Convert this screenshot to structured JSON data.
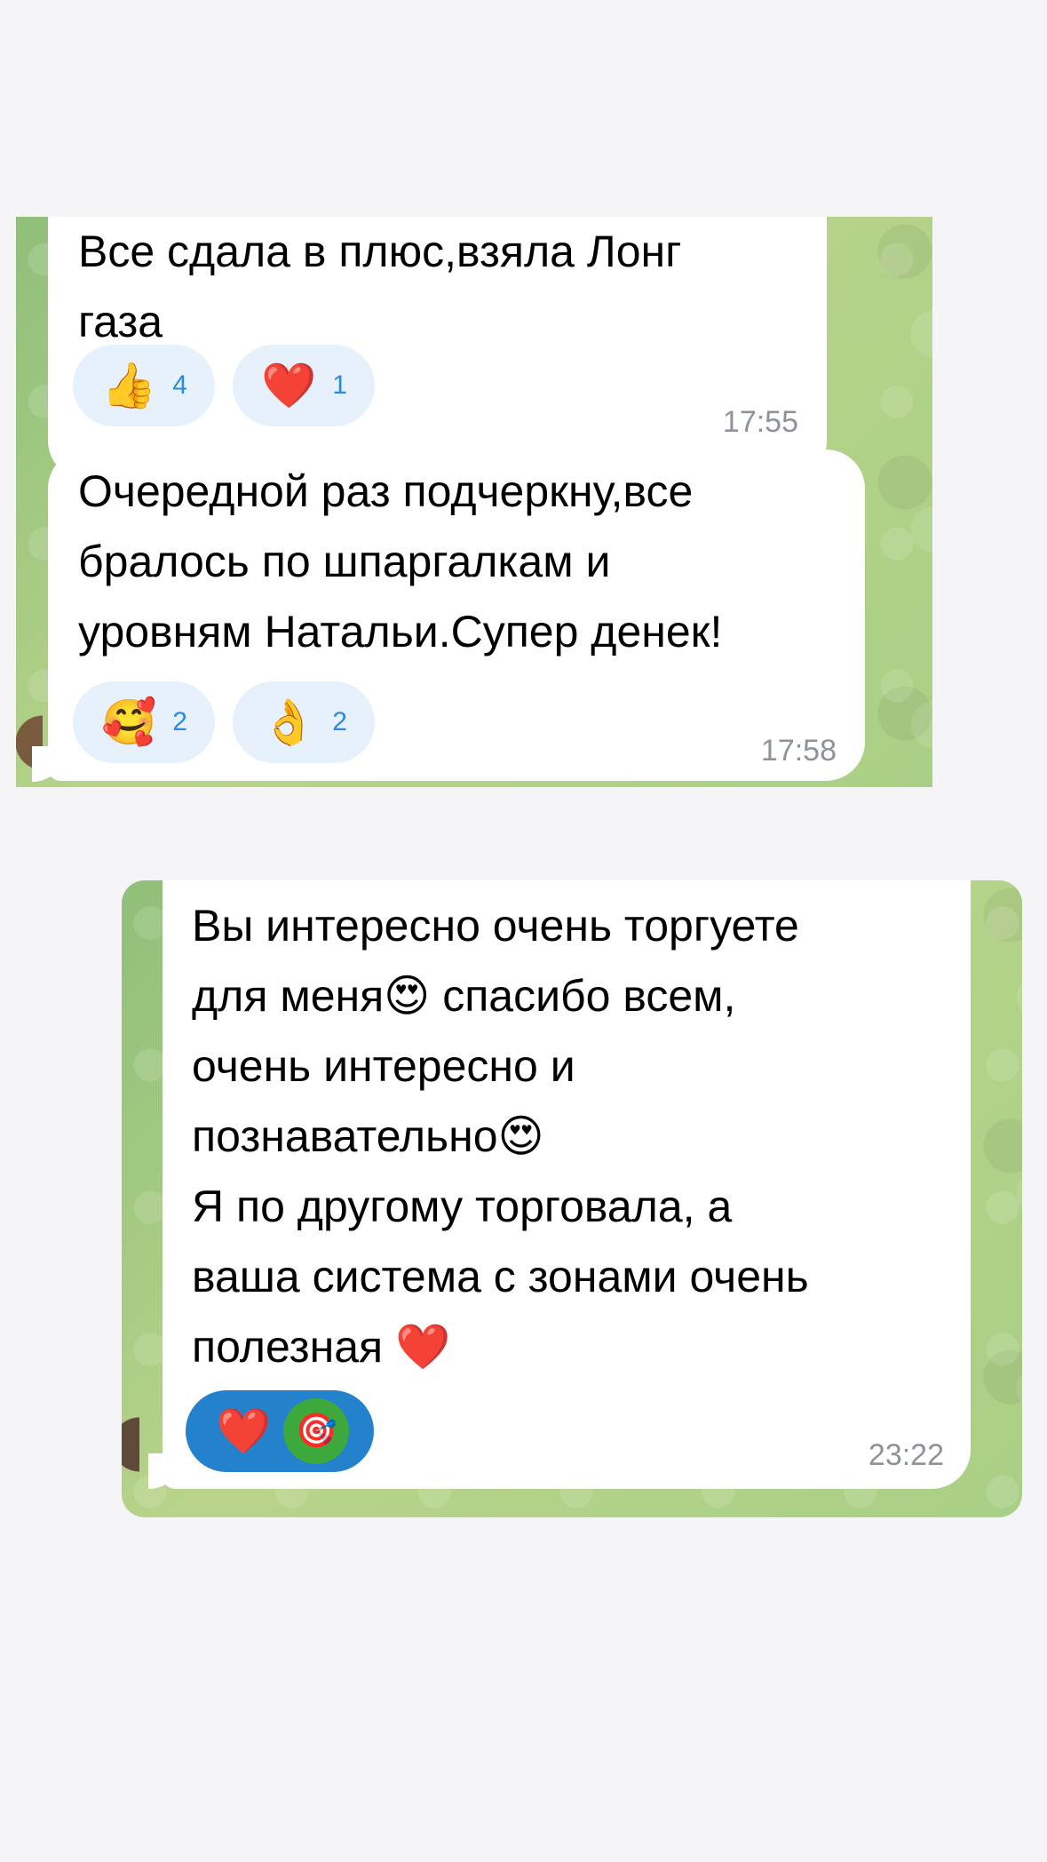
{
  "screenshot_1": {
    "messages": [
      {
        "text": "Все сдала в плюс,взяла Лонг\nгаза",
        "reactions": [
          {
            "emoji": "👍",
            "count": "4"
          },
          {
            "emoji": "❤️",
            "count": "1"
          }
        ],
        "time": "17:55"
      },
      {
        "text": "Очередной раз подчеркну,все\nбралось по шпаргалкам и\nуровням Натальи.Супер денек!",
        "reactions": [
          {
            "emoji": "🥰",
            "count": "2"
          },
          {
            "emoji": "👌",
            "count": "2"
          }
        ],
        "time": "17:58"
      }
    ]
  },
  "screenshot_2": {
    "message": {
      "text": "Вы интересно очень торгуете\nдля меня😍 спасибо всем,\nочень интересно и\nпознавательно😍\nЯ по другому торговала, а\nваша система с зонами очень\nполезная ❤️",
      "reaction": {
        "emoji": "❤️",
        "extra_emoji": "🎯"
      },
      "time": "23:22"
    }
  },
  "colors": {
    "page_background": "#f5f5f7",
    "chat_wallpaper": "#a9cf86",
    "bubble": "#ffffff",
    "reaction_background": "#e7f1fb",
    "reaction_count": "#2a8ae0",
    "reaction_selected": "#2481cc",
    "time_text": "#8e939a"
  }
}
